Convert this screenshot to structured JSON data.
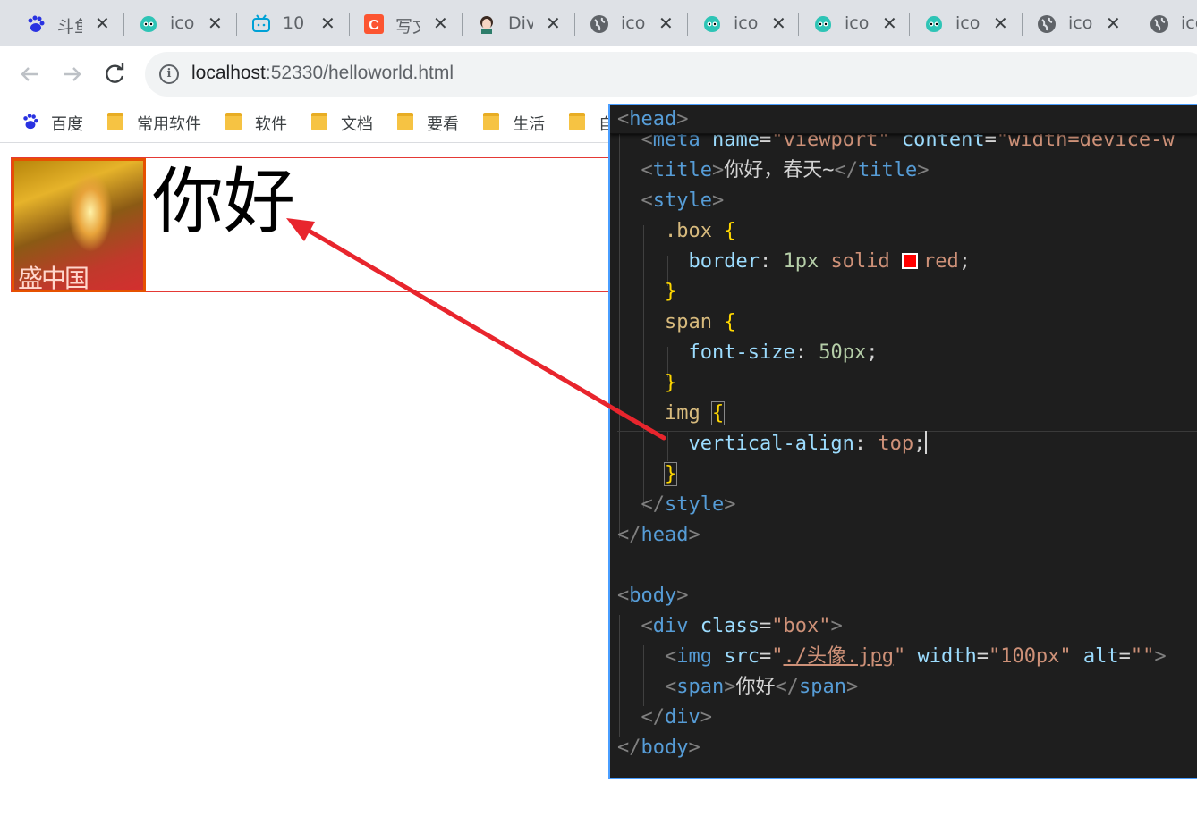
{
  "browser": {
    "tabs": [
      {
        "title": "斗鱼",
        "icon": "baidu-paw-icon"
      },
      {
        "title": "icon",
        "icon": "iconfont-icon"
      },
      {
        "title": "10",
        "icon": "bilibili-icon"
      },
      {
        "title": "写文",
        "icon": "csdn-icon"
      },
      {
        "title": "Div",
        "icon": "avatar-icon"
      },
      {
        "title": "icon",
        "icon": "globe-icon"
      },
      {
        "title": "icon",
        "icon": "iconfont-icon"
      },
      {
        "title": "icon",
        "icon": "iconfont-icon"
      },
      {
        "title": "icon",
        "icon": "iconfont-icon"
      },
      {
        "title": "icon",
        "icon": "globe-icon"
      },
      {
        "title": "ico",
        "icon": "globe-icon"
      }
    ],
    "close_glyph": "✕",
    "url_host": "localhost",
    "url_rest": ":52330/helloworld.html",
    "bookmarks": [
      {
        "label": "百度",
        "icon": "baidu-paw-icon"
      },
      {
        "label": "常用软件",
        "icon": "folder-icon"
      },
      {
        "label": "软件",
        "icon": "folder-icon"
      },
      {
        "label": "文档",
        "icon": "folder-icon"
      },
      {
        "label": "要看",
        "icon": "folder-icon"
      },
      {
        "label": "生活",
        "icon": "folder-icon"
      },
      {
        "label": "自",
        "icon": "folder-icon"
      }
    ]
  },
  "page": {
    "greeting": "你好",
    "image_caption": "盛中国",
    "border_color": "#e53935"
  },
  "editor": {
    "lines": {
      "head_open": "head",
      "meta_name_attr": "name",
      "meta_name_val": "\"viewport\"",
      "meta_content_attr": "content",
      "meta_content_val": "\"width=device-w",
      "title_tag": "title",
      "title_text": "你好，春天~",
      "style_tag": "style",
      "box_selector": ".box",
      "border_prop": "border",
      "border_num": "1px",
      "border_style": "solid",
      "border_color": "red",
      "span_selector": "span",
      "fontsize_prop": "font-size",
      "fontsize_val": "50px",
      "img_selector": "img",
      "valign_prop": "vertical-align",
      "valign_val": "top",
      "head_close": "head",
      "body_tag": "body",
      "div_tag": "div",
      "class_attr": "class",
      "class_val": "\"box\"",
      "img_tag": "img",
      "src_attr": "src",
      "src_val": "./头像.jpg",
      "width_attr": "width",
      "width_val": "\"100px\"",
      "alt_attr": "alt",
      "alt_val": "\"\"",
      "span_tag": "span",
      "span_text": "你好"
    }
  },
  "colors": {
    "arrow": "#e8252d",
    "panel_border": "#4a9eff",
    "editor_bg": "#1e1e1e"
  }
}
